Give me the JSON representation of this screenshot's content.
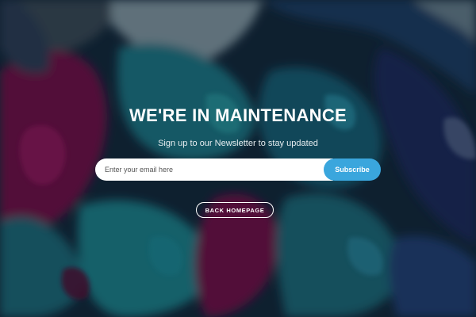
{
  "page": {
    "title": "WE'RE IN MAINTENANCE",
    "subtitle": "Sign up to our Newsletter to stay updated"
  },
  "newsletter": {
    "email_placeholder": "Enter your email here",
    "email_value": "",
    "subscribe_label": "Subscribe"
  },
  "actions": {
    "back_label": "BACK HOMEPAGE"
  },
  "colors": {
    "accent": "#3aa6dd",
    "text": "#ffffff",
    "background_teal": "#1f7f8c",
    "background_magenta": "#7a0f4a",
    "background_navy": "#1b2a5e"
  }
}
